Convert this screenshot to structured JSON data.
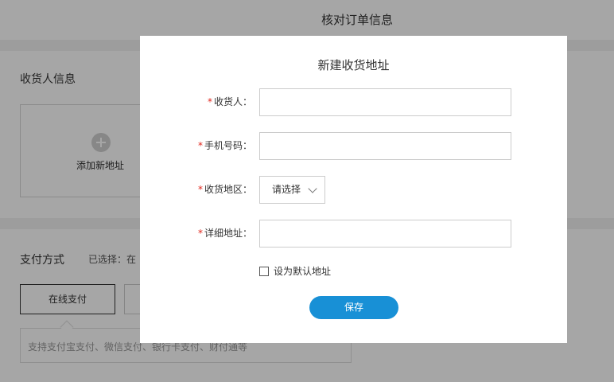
{
  "page": {
    "title": "核对订单信息",
    "consignee": {
      "title": "收货人信息",
      "add_address_label": "添加新地址"
    },
    "payment": {
      "title": "支付方式",
      "selected_label": "已选择：在",
      "online_label": "在线支付",
      "description": "支持支付宝支付、微信支付、银行卡支付、财付通等"
    }
  },
  "modal": {
    "title": "新建收货地址",
    "required_mark": "*",
    "fields": {
      "consignee": {
        "label": "收货人：",
        "value": ""
      },
      "phone": {
        "label": "手机号码：",
        "value": ""
      },
      "region": {
        "label": "收货地区：",
        "value": "请选择"
      },
      "detail": {
        "label": "详细地址：",
        "value": ""
      }
    },
    "default_checkbox_label": "设为默认地址",
    "default_checked": false,
    "save_label": "保存"
  },
  "colors": {
    "primary": "#1890d6",
    "required": "#e1251b",
    "overlay": "rgba(0,0,0,0.35)"
  },
  "icons": [
    "plus-circle-icon",
    "chevron-down-icon"
  ]
}
